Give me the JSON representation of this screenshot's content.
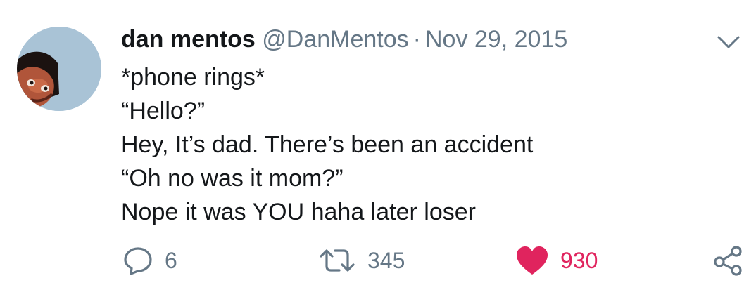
{
  "tweet": {
    "author_name": "dan mentos",
    "author_handle": "@DanMentos",
    "separator": "·",
    "date": "Nov 29, 2015",
    "lines": [
      "*phone rings*",
      "“Hello?”",
      "Hey, It’s dad. There’s been an accident",
      "“Oh no was it mom?”",
      "Nope it was YOU haha later loser"
    ]
  },
  "actions": {
    "reply_count": "6",
    "retweet_count": "345",
    "like_count": "930"
  },
  "icons": {
    "avatar": "avatar-image",
    "caret": "chevron-down-icon",
    "reply": "reply-icon",
    "retweet": "retweet-icon",
    "like": "heart-icon",
    "share": "share-icon"
  },
  "colors": {
    "text": "#14171a",
    "secondary": "#657786",
    "like": "#e0245e",
    "avatar_bg": "#a9c3d6"
  }
}
